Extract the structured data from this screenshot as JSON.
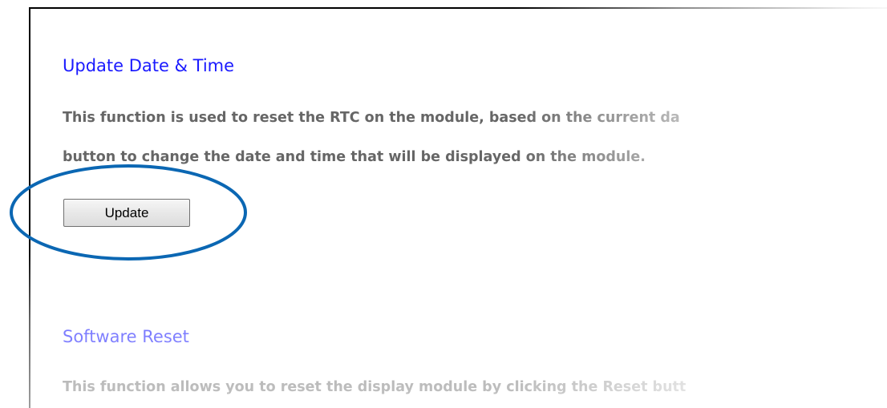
{
  "sections": {
    "update_datetime": {
      "title": "Update Date & Time",
      "description_line1": "This function is used to reset the RTC on the module, based on the current da",
      "description_line2": "button to change the date and time that will be displayed on the module.",
      "button_label": "Update"
    },
    "software_reset": {
      "title": "Software Reset",
      "description_line1": "This function allows you to reset the display module by clicking the Reset butt"
    }
  },
  "annotation": {
    "shape": "ellipse",
    "color": "#0b67b3",
    "target": "update-button"
  },
  "colors": {
    "heading": "#1a1aff",
    "body_text": "#666666",
    "panel_border": "#000000"
  }
}
